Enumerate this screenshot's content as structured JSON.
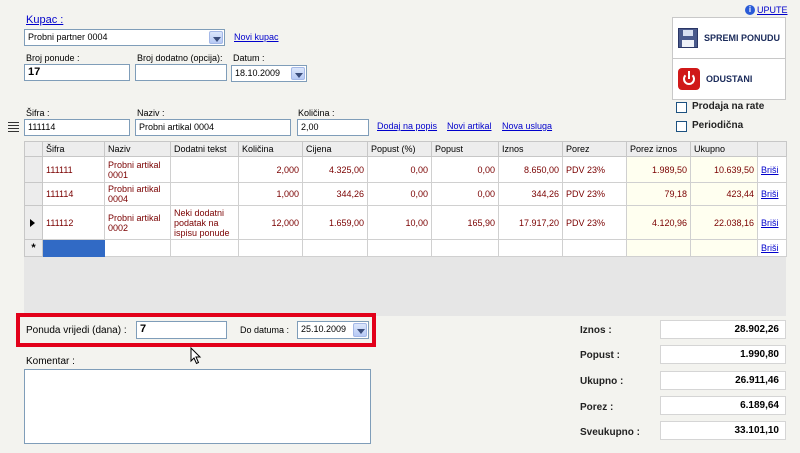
{
  "header": {
    "help_link": "UPUTE",
    "customer_label": "Kupac :",
    "customer_value": "Probni partner 0004",
    "new_customer_link": "Novi kupac",
    "offer_number_label": "Broj ponude :",
    "offer_number_value": "17",
    "extra_number_label": "Broj dodatno (opcija):",
    "extra_number_value": "",
    "date_label": "Datum :",
    "date_value": "18.10.2009"
  },
  "actions": {
    "save_label": "SPREMI PONUDU",
    "cancel_label": "ODUSTANI",
    "installments_label": "Prodaja na rate",
    "periodic_label": "Periodična"
  },
  "entry": {
    "code_label": "Šifra :",
    "code_value": "111114",
    "name_label": "Naziv :",
    "name_value": "Probni artikal 0004",
    "qty_label": "Količina :",
    "qty_value": "2,00",
    "add_link": "Dodaj na popis",
    "new_item_link": "Novi artikal",
    "new_service_link": "Nova usluga"
  },
  "grid": {
    "columns": [
      "Šifra",
      "Naziv",
      "Dodatni tekst",
      "Količina",
      "Cijena",
      "Popust (%)",
      "Popust",
      "Iznos",
      "Porez",
      "Porez iznos",
      "Ukupno"
    ],
    "delete_label": "Briši",
    "rows": [
      {
        "code": "111111",
        "name": "Probni artikal 0001",
        "extra": "",
        "qty": "2,000",
        "price": "4.325,00",
        "disc_pct": "0,00",
        "disc": "0,00",
        "amount": "8.650,00",
        "tax": "PDV 23%",
        "tax_amount": "1.989,50",
        "total": "10.639,50"
      },
      {
        "code": "111114",
        "name": "Probni artikal 0004",
        "extra": "",
        "qty": "1,000",
        "price": "344,26",
        "disc_pct": "0,00",
        "disc": "0,00",
        "amount": "344,26",
        "tax": "PDV 23%",
        "tax_amount": "79,18",
        "total": "423,44"
      },
      {
        "code": "111112",
        "name": "Probni artikal 0002",
        "extra": "Neki dodatni podatak na ispisu ponude",
        "qty": "12,000",
        "price": "1.659,00",
        "disc_pct": "10,00",
        "disc": "165,90",
        "amount": "17.917,20",
        "tax": "PDV 23%",
        "tax_amount": "4.120,96",
        "total": "22.038,16"
      }
    ]
  },
  "validity": {
    "days_label": "Ponuda vrijedi (dana) :",
    "days_value": "7",
    "until_label": "Do datuma :",
    "until_value": "25.10.2009"
  },
  "comment": {
    "label": "Komentar :",
    "value": ""
  },
  "totals": [
    {
      "label": "Iznos :",
      "value": "28.902,26"
    },
    {
      "label": "Popust :",
      "value": "1.990,80"
    },
    {
      "label": "Ukupno :",
      "value": "26.911,46"
    },
    {
      "label": "Porez :",
      "value": "6.189,64"
    },
    {
      "label": "Sveukupno :",
      "value": "33.101,10"
    }
  ],
  "colors": {
    "highlight": "#e2001a",
    "link": "#0000cc",
    "amount_text": "#7a0000"
  }
}
